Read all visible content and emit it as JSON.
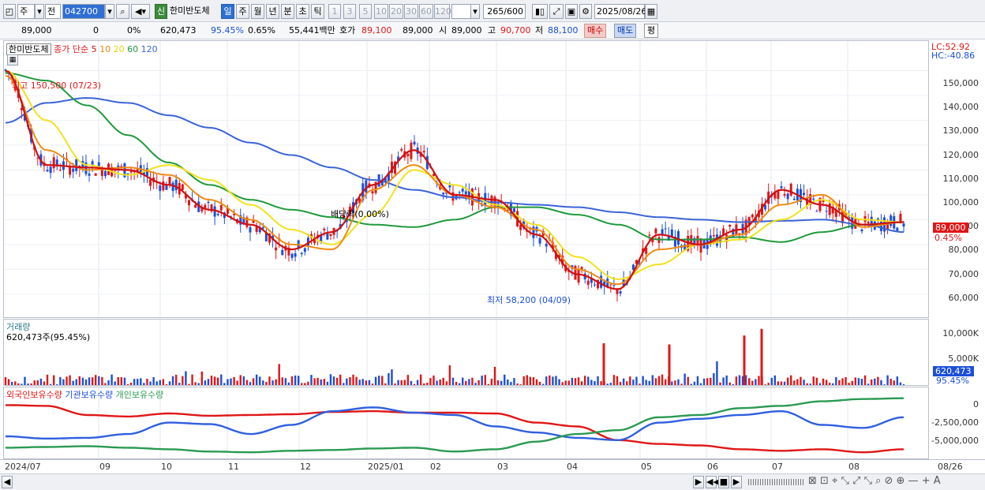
{
  "toolbar": {
    "period_type": "주",
    "prev_label": "전",
    "stock_code": "042700",
    "new_badge": "신",
    "stock_name": "한미반도체",
    "periods": [
      "일",
      "주",
      "월",
      "년",
      "분",
      "초",
      "틱"
    ],
    "active_period": "일",
    "intervals": [
      "1",
      "3",
      "5",
      "10",
      "20",
      "30",
      "60",
      "120"
    ],
    "count": "265",
    "count_total": "/600",
    "date": "2025/08/26"
  },
  "quote": {
    "price": "89,000",
    "change": "0",
    "change_pct": "0%",
    "volume": "620,473",
    "volume_ratio": "95.45%",
    "turnover_ratio": "0.65%",
    "amount": "55,441백만",
    "bid_label": "호가",
    "bid": "89,100",
    "last": "89,000",
    "open_label": "시",
    "open": "89,000",
    "high_label": "고",
    "high": "90,700",
    "low_label": "저",
    "low": "88,100",
    "buy_label": "매수",
    "sell_label": "매도",
    "eval_label": "평"
  },
  "price_pane": {
    "name": "한미반도체",
    "ma_label": "종가 단순",
    "ma_periods": [
      "5",
      "10",
      "20",
      "60",
      "120"
    ],
    "lc": "LC:52.92",
    "hc": "HC:-40.86",
    "max_annotation": "최고 150,500 (07/23)",
    "min_annotation": "최저 58,200 (04/09)",
    "dividend_annotation": "배당락(0.00%)",
    "current_price_tag": "89,000",
    "current_pct_tag": "0.45%",
    "y_ticks": [
      "150,000",
      "140,000",
      "130,000",
      "120,000",
      "110,000",
      "100,000",
      "90,000",
      "80,000",
      "70,000",
      "60,000"
    ]
  },
  "volume_pane": {
    "title": "거래량",
    "value": "620,473주(95.45%)",
    "y_ticks": [
      "10,000K",
      "5,000K"
    ],
    "current_tag": "620,473",
    "current_pct": "95.45%"
  },
  "holding_pane": {
    "series": [
      "외국인보유수량",
      "기관보유수량",
      "개인보유수량"
    ],
    "y_ticks": [
      "0",
      "-2,500,000",
      "-5,000,000"
    ]
  },
  "x_axis": [
    "2024/07",
    "09",
    "10",
    "11",
    "12",
    "2025/01",
    "02",
    "03",
    "04",
    "05",
    "06",
    "07",
    "08",
    "08/26"
  ],
  "colors": {
    "up": "#e01616",
    "down": "#1b4fd8",
    "ma5": "#d01010",
    "ma10": "#f08a10",
    "ma20": "#f2e21c",
    "ma60": "#1e9a3c",
    "ma120": "#3a63d8",
    "foreign": "#e01616",
    "institution": "#2f5fe0",
    "individual": "#2a9a52"
  },
  "chart_data": {
    "type": "candlestick",
    "y_range": [
      52000,
      160000
    ],
    "ma120": [
      129000,
      137000,
      139000,
      137000,
      132000,
      127000,
      121000,
      116000,
      111000,
      106000,
      102000,
      99000,
      97000,
      96000,
      95000,
      93000,
      91000,
      90000,
      89000,
      89500,
      90000,
      88000,
      85000
    ],
    "ma60": [
      149000,
      146000,
      136000,
      124000,
      113000,
      104000,
      98000,
      94000,
      91000,
      88000,
      87000,
      90000,
      95000,
      95000,
      92000,
      88000,
      82000,
      82000,
      83000,
      81000,
      85000,
      88000,
      89000
    ],
    "ma20": [
      150000,
      130000,
      112000,
      108000,
      112000,
      106000,
      96000,
      86000,
      80000,
      92000,
      110000,
      104000,
      96000,
      88000,
      75000,
      66000,
      72000,
      80000,
      82000,
      90000,
      98000,
      90000,
      89000
    ],
    "ma10": [
      148000,
      118000,
      110000,
      111000,
      108000,
      98000,
      90000,
      80000,
      78000,
      102000,
      112000,
      100000,
      95000,
      86000,
      70000,
      64000,
      78000,
      80000,
      84000,
      96000,
      100000,
      87000,
      89000
    ],
    "ma5": [
      150000,
      112000,
      111000,
      110000,
      104000,
      94000,
      88000,
      78000,
      85000,
      104000,
      118000,
      100000,
      98000,
      84000,
      68000,
      62000,
      84000,
      80000,
      86000,
      102000,
      96000,
      88000,
      89000
    ],
    "volume_spikes": [
      {
        "date": "04",
        "value": 7800
      },
      {
        "date": "05",
        "value": 7600
      },
      {
        "date": "07",
        "value": 9200
      },
      {
        "date": "07",
        "value": 10400
      }
    ],
    "holdings": {
      "foreign": [
        -200000,
        -300000,
        -1500000,
        -1700000,
        -1300000,
        -1600000,
        -1500000,
        -1400000,
        -1100000,
        -1000000,
        -1200000,
        -1200000,
        -1300000,
        -2500000,
        -3000000,
        -4800000,
        -5300000,
        -5500000,
        -6000000,
        -6200000,
        -6000000,
        -6400000,
        -6000000
      ],
      "institution": [
        -4300000,
        -4600000,
        -4500000,
        -4000000,
        -2500000,
        -2700000,
        -4000000,
        -2800000,
        -1000000,
        -500000,
        -1200000,
        -1500000,
        -3000000,
        -3800000,
        -4500000,
        -4800000,
        -2500000,
        -2000000,
        -1500000,
        -1000000,
        -2800000,
        -3200000,
        -1800000
      ],
      "individual": [
        -5800000,
        -5700000,
        -5600000,
        -5800000,
        -6000000,
        -6300000,
        -6400000,
        -6200000,
        -6100000,
        -5900000,
        -5800000,
        -6300000,
        -6000000,
        -5000000,
        -4000000,
        -3500000,
        -1800000,
        -1500000,
        -600000,
        -300000,
        300000,
        600000,
        700000
      ]
    }
  }
}
